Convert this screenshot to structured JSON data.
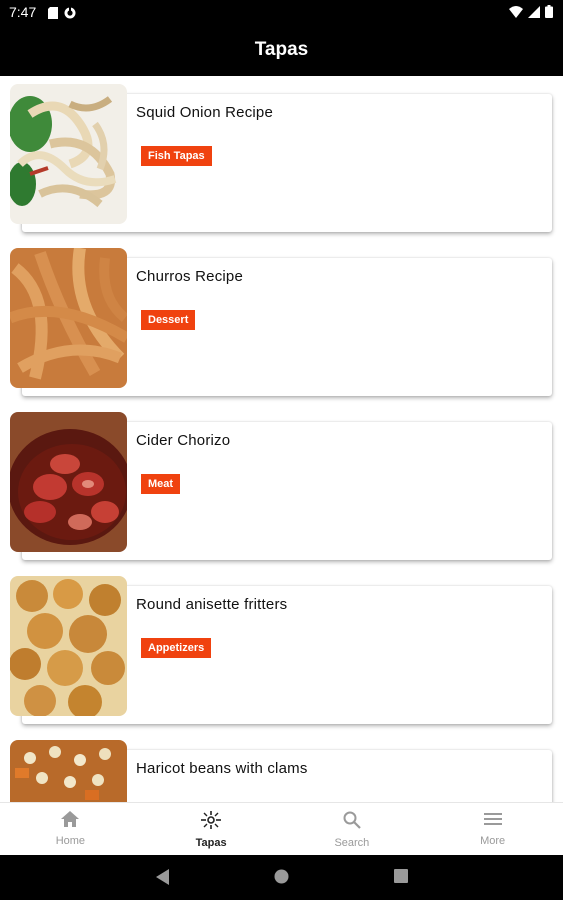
{
  "status_bar": {
    "time": "7:47"
  },
  "app_bar": {
    "title": "Tapas"
  },
  "recipes": [
    {
      "title": "Squid Onion Recipe",
      "tag": "Fish Tapas"
    },
    {
      "title": "Churros Recipe",
      "tag": "Dessert"
    },
    {
      "title": "Cider Chorizo",
      "tag": "Meat"
    },
    {
      "title": "Round anisette fritters",
      "tag": "Appetizers"
    },
    {
      "title": "Haricot beans with clams",
      "tag": ""
    }
  ],
  "bottom_nav": [
    {
      "label": "Home",
      "icon": "home-icon",
      "active": false
    },
    {
      "label": "Tapas",
      "icon": "tapas-icon",
      "active": true
    },
    {
      "label": "Search",
      "icon": "search-icon",
      "active": false
    },
    {
      "label": "More",
      "icon": "menu-icon",
      "active": false
    }
  ],
  "colors": {
    "accent": "#f0420f",
    "app_bar": "#000000",
    "nav_inactive": "#9a9a9a"
  }
}
